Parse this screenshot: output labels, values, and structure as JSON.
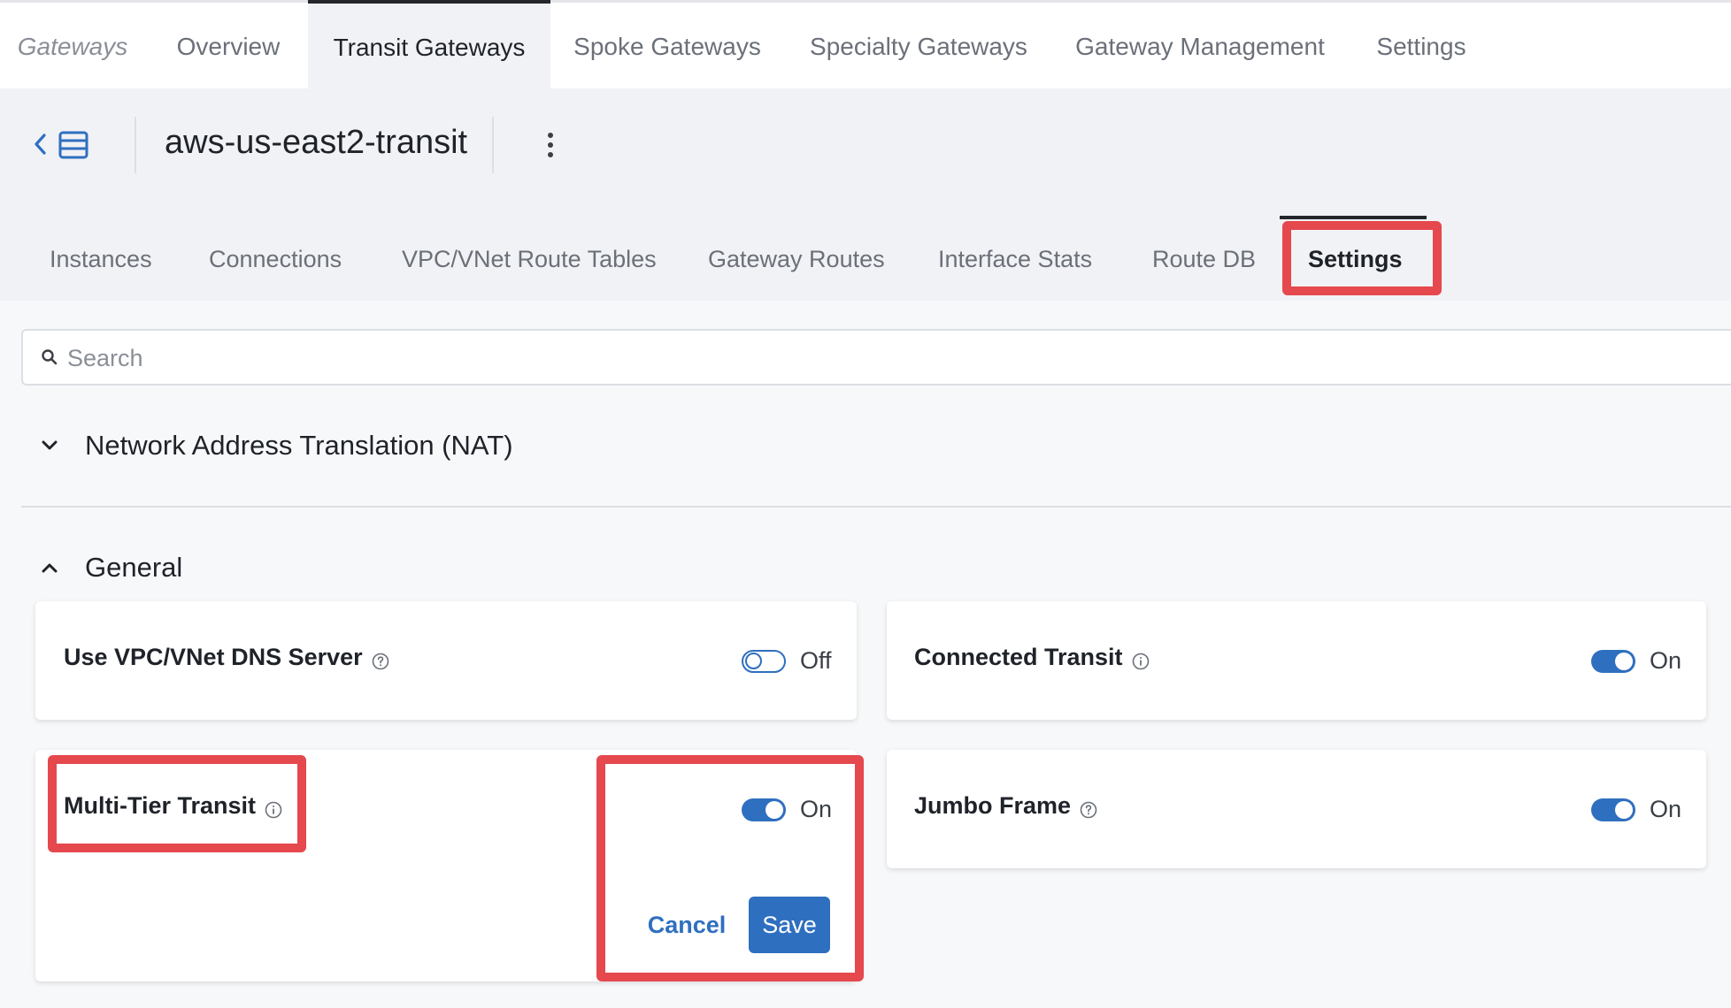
{
  "topnav": {
    "brand": "Gateways",
    "items": [
      "Overview",
      "Transit Gateways",
      "Spoke Gateways",
      "Specialty Gateways",
      "Gateway Management",
      "Settings"
    ],
    "active": "Transit Gateways"
  },
  "header": {
    "title": "aws-us-east2-transit"
  },
  "subtabs": {
    "items": [
      "Instances",
      "Connections",
      "VPC/VNet Route Tables",
      "Gateway Routes",
      "Interface Stats",
      "Route DB",
      "Settings"
    ],
    "active": "Settings"
  },
  "search": {
    "placeholder": "Search",
    "value": ""
  },
  "sections": {
    "nat": {
      "title": "Network Address Translation (NAT)",
      "expanded": false
    },
    "general": {
      "title": "General",
      "expanded": true
    }
  },
  "settings": {
    "vpc_dns": {
      "label": "Use VPC/VNet DNS Server",
      "state": "Off",
      "icon": "help-circle-icon"
    },
    "connected_transit": {
      "label": "Connected Transit",
      "state": "On",
      "icon": "info-circle-icon"
    },
    "multi_tier": {
      "label": "Multi-Tier Transit",
      "state": "On",
      "icon": "info-circle-icon"
    },
    "jumbo_frame": {
      "label": "Jumbo Frame",
      "state": "On",
      "icon": "help-circle-icon"
    }
  },
  "actions": {
    "cancel": "Cancel",
    "save": "Save"
  },
  "colors": {
    "accent": "#2f6fbf",
    "highlight": "#e5484d",
    "active_tab_bar": "#23262b"
  }
}
